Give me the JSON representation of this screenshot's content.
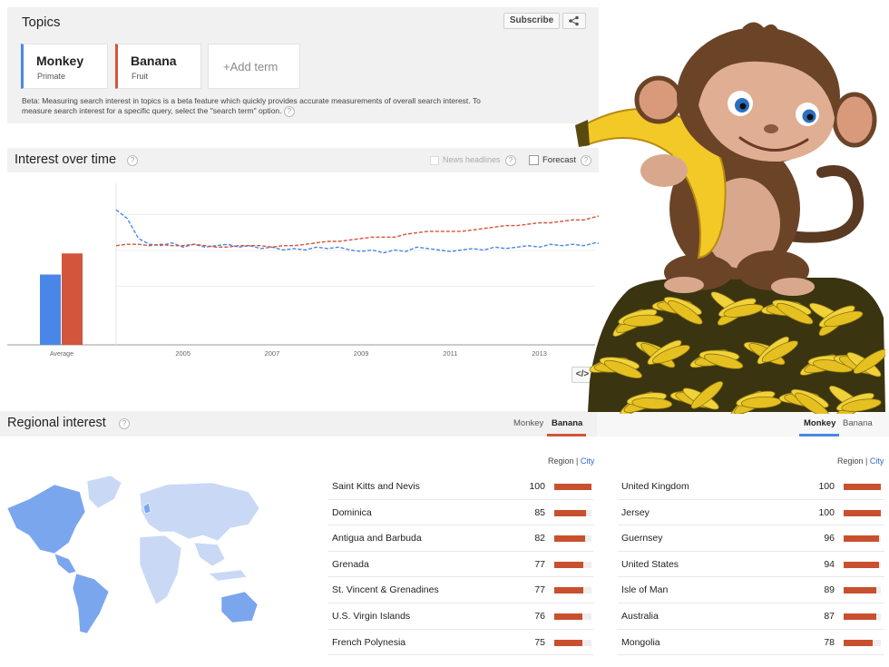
{
  "topics": {
    "title": "Topics",
    "subscribe_label": "Subscribe",
    "terms": [
      {
        "title": "Monkey",
        "subtitle": "Primate",
        "color": "#4a86e8"
      },
      {
        "title": "Banana",
        "subtitle": "Fruit",
        "color": "#d2553c"
      }
    ],
    "add_term_label": "+Add term",
    "beta_note": "Beta: Measuring search interest in topics is a beta feature which quickly provides accurate measurements of overall search interest. To measure search interest for a specific query, select the \"search term\" option."
  },
  "interest_over_time": {
    "title": "Interest over time",
    "help": "?",
    "news_headlines_label": "News headlines",
    "forecast_label": "Forecast"
  },
  "chart_data": {
    "type": "line",
    "x_ticks": [
      "2005",
      "2007",
      "2009",
      "2011",
      "2013"
    ],
    "average_label": "Average",
    "average": [
      {
        "name": "Monkey",
        "value": 50,
        "color": "#4a86e8"
      },
      {
        "name": "Banana",
        "value": 65,
        "color": "#d2553c"
      }
    ],
    "series": [
      {
        "name": "Monkey",
        "color": "#4a86e8",
        "x_start": 2004.0,
        "x_step": 0.25,
        "values": [
          72,
          66,
          52,
          48,
          47,
          49,
          46,
          48,
          46,
          47,
          48,
          46,
          47,
          45,
          46,
          44,
          45,
          44,
          46,
          45,
          46,
          44,
          43,
          44,
          42,
          44,
          43,
          46,
          45,
          44,
          43,
          44,
          45,
          44,
          46,
          45,
          46,
          47,
          46,
          48,
          47,
          48,
          47,
          49,
          48,
          50,
          49,
          48,
          58,
          47,
          48,
          49,
          48,
          49,
          48,
          50,
          49,
          48,
          49,
          48,
          49,
          50,
          49,
          48
        ]
      },
      {
        "name": "Banana",
        "color": "#d2553c",
        "x_start": 2004.0,
        "x_step": 0.25,
        "values": [
          47,
          48,
          48,
          47,
          48,
          47,
          47,
          48,
          47,
          46,
          46,
          47,
          47,
          47,
          46,
          47,
          47,
          48,
          49,
          50,
          50,
          51,
          52,
          53,
          53,
          53,
          55,
          56,
          57,
          57,
          57,
          57,
          58,
          59,
          60,
          61,
          61,
          62,
          63,
          63,
          64,
          65,
          65,
          67,
          69,
          71,
          73,
          70,
          76,
          78,
          80,
          82,
          84,
          85,
          88,
          89,
          90,
          92,
          94,
          95,
          97,
          100,
          99,
          93
        ]
      }
    ],
    "grid": true
  },
  "regional": {
    "title": "Regional interest",
    "help": "?",
    "tabs": [
      "Monkey",
      "Banana"
    ],
    "region_label": "Region",
    "city_label": "City",
    "banana_rows": [
      {
        "name": "Saint Kitts and Nevis",
        "value": 100
      },
      {
        "name": "Dominica",
        "value": 85
      },
      {
        "name": "Antigua and Barbuda",
        "value": 82
      },
      {
        "name": "Grenada",
        "value": 77
      },
      {
        "name": "St. Vincent & Grenadines",
        "value": 77
      },
      {
        "name": "U.S. Virgin Islands",
        "value": 76
      },
      {
        "name": "French Polynesia",
        "value": 75
      }
    ],
    "monkey_rows": [
      {
        "name": "United Kingdom",
        "value": 100
      },
      {
        "name": "Jersey",
        "value": 100
      },
      {
        "name": "Guernsey",
        "value": 96
      },
      {
        "name": "United States",
        "value": 94
      },
      {
        "name": "Isle of Man",
        "value": 89
      },
      {
        "name": "Australia",
        "value": 87
      },
      {
        "name": "Mongolia",
        "value": 78
      }
    ]
  },
  "icons": {
    "share": "share-icon",
    "embed": "embed-icon",
    "illustration": "monkey-with-bananas-illustration"
  }
}
